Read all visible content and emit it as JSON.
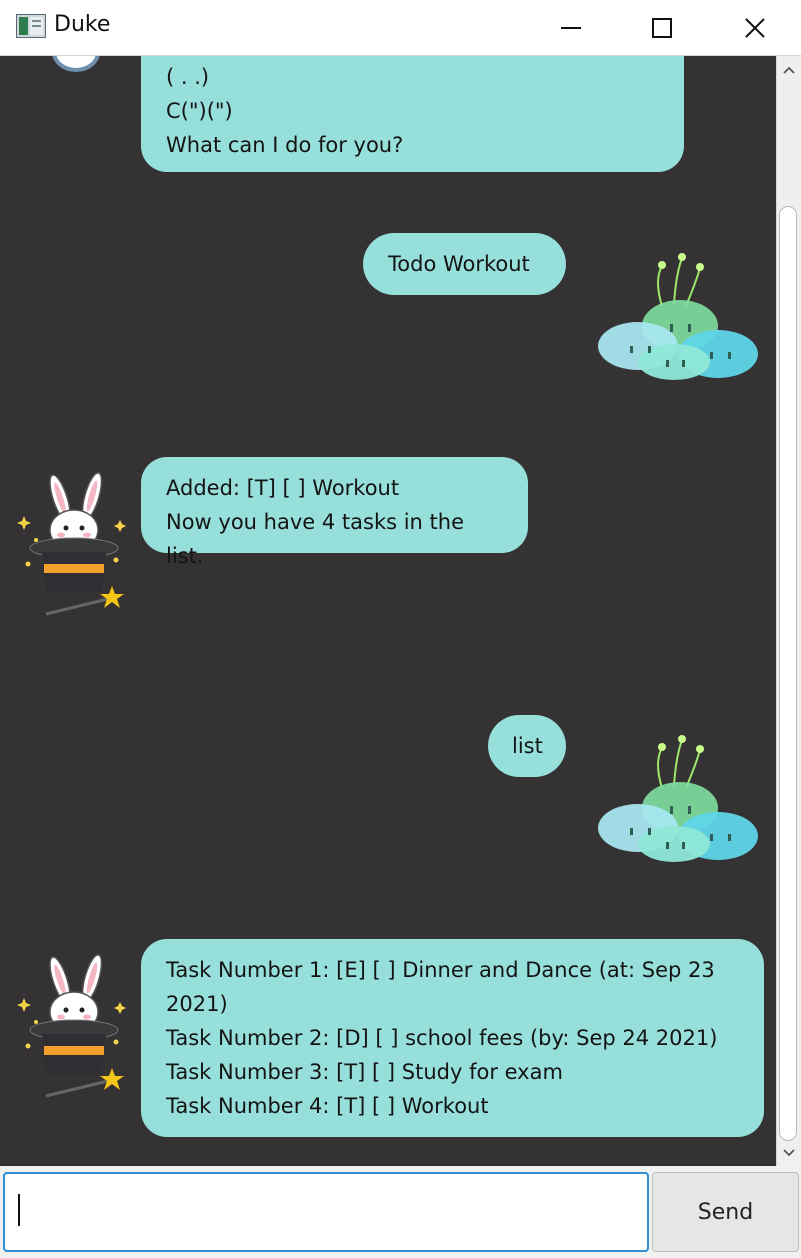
{
  "window": {
    "title": "Duke",
    "minimize_icon": "minimize-icon",
    "maximize_icon": "maximize-icon",
    "close_icon": "close-icon"
  },
  "chat": {
    "messages": [
      {
        "sender": "duke",
        "lines": [
          "( . .)",
          "C(\")(\")",
          "What can I do for you?"
        ]
      },
      {
        "sender": "user",
        "lines": [
          "Todo Workout"
        ]
      },
      {
        "sender": "duke",
        "lines": [
          "Added: [T] [ ] Workout",
          "Now you have 4 tasks in the list."
        ]
      },
      {
        "sender": "user",
        "lines": [
          "list"
        ]
      },
      {
        "sender": "duke",
        "lines": [
          "Task Number 1: [E] [ ] Dinner and Dance (at: Sep 23",
          "2021)",
          "Task Number 2: [D] [ ] school fees (by: Sep 24 2021)",
          "Task Number 3: [T] [ ] Study for exam",
          "Task Number 4: [T] [ ] Workout"
        ]
      }
    ],
    "duke_avatar": "bunny-magician-avatar",
    "user_avatar": "slime-stack-avatar"
  },
  "input": {
    "value": "",
    "placeholder": ""
  },
  "send": {
    "label": "Send"
  },
  "colors": {
    "bubble": "#97dfda",
    "chat_bg": "#353233",
    "focus": "#2f8fd2"
  }
}
